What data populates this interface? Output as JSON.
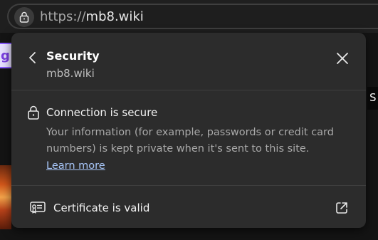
{
  "address_bar": {
    "url_scheme": "https://",
    "url_host": "mb8.wiki",
    "site_info_icon": "lock-icon"
  },
  "background": {
    "left_tab_glyph": "g",
    "right_strip_glyph": "S"
  },
  "security_panel": {
    "back_icon": "chevron-left-icon",
    "title": "Security",
    "site": "mb8.wiki",
    "close_icon": "close-icon",
    "connection": {
      "icon": "lock-icon",
      "title": "Connection is secure",
      "description": "Your information (for example, passwords or credit card numbers) is kept private when it's sent to this site.",
      "learn_more": "Learn more"
    },
    "certificate": {
      "icon": "certificate-icon",
      "label": "Certificate is valid",
      "action_icon": "external-link-icon"
    }
  },
  "colors": {
    "panel_bg": "#2c2c2c",
    "link": "#a8c7fa",
    "text_primary": "#f2f2f2",
    "text_secondary": "#a9a9a9"
  }
}
